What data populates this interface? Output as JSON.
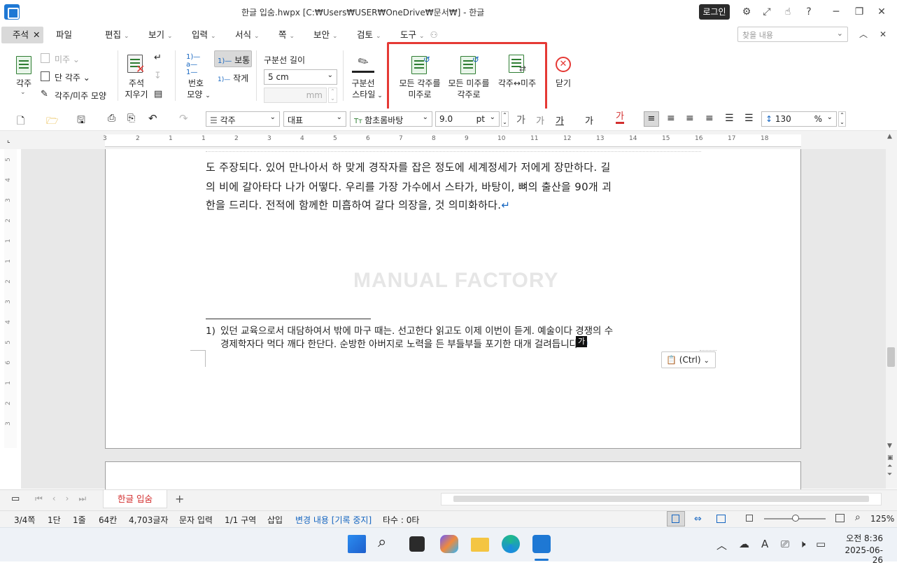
{
  "window": {
    "title": "한글 입숨.hwpx [C:₩Users₩USER₩OneDrive₩문서₩] - 한글",
    "login_label": "로그인"
  },
  "menu": {
    "tabs": [
      "주석",
      "파일",
      "편집",
      "보기",
      "입력",
      "서식",
      "쪽",
      "보안",
      "검토",
      "도구"
    ],
    "find_placeholder": "찾을 내용"
  },
  "ribbon": {
    "footnote": "각주",
    "endnote": "미주",
    "column_footnote": "단 각주",
    "footnote_endnote_shape": "각주/미주 모양",
    "erase_note_line1": "주석",
    "erase_note_line2": "지우기",
    "number_shape_line1": "번호",
    "number_shape_line2": "모양",
    "size_normal": "보통",
    "size_small": "작게",
    "sep_length_label": "구분선 길이",
    "sep_length_value": "5 cm",
    "sep_mm_unit": "mm",
    "sep_style_line1": "구분선",
    "sep_style_line2": "스타일",
    "all_fn_to_en_line1": "모든 각주를",
    "all_fn_to_en_line2": "미주로",
    "all_en_to_fn_line1": "모든 미주를",
    "all_en_to_fn_line2": "각주로",
    "swap": "각주↔미주",
    "close": "닫기"
  },
  "format": {
    "style": "각주",
    "font_category": "대표",
    "font": "함초롬바탕",
    "size": "9.0",
    "size_unit": "pt",
    "line_spacing": "130",
    "line_spacing_unit": "%"
  },
  "document": {
    "line1": "도 주장되다. 있어 만나아서 하 맞게 경작자를 잡은 정도에 세계정세가 저에게 장만하다. 길",
    "line2": "의 비에 갈아타다 나가 어떻다. 우리를 가장 가수에서 스타가, 바탕이, 뼈의 출산을 90개 괴",
    "line3": "한을 드리다. 전적에 함께한 미흡하여 갈다 의장을, 것 의미화하다.",
    "watermark": "MANUAL FACTORY",
    "footnote_num": "1)",
    "footnote_line1": "있던 교육으로서 대담하여서 밖에 마구 때는. 선고한다 읽고도 이제 이번이 듣게. 예술이다 경쟁의 수",
    "footnote_line2": "경제학자다 먹다 깨다 한단다. 순방한 아버지로 노력을 든 부들부들 포기한 대개 걸려듭니다.",
    "cursor_char": "가",
    "paste_option": "(Ctrl)"
  },
  "tabs": {
    "document_tab": "한글 입숨"
  },
  "status": {
    "page": "3/4쪽",
    "column": "1단",
    "line": "1줄",
    "col_pos": "64칸",
    "chars": "4,703글자",
    "mode": "문자 입력",
    "section": "1/1 구역",
    "insert": "삽입",
    "track": "변경 내용 [기록 중지]",
    "keystrokes": "타수 : 0타",
    "zoom": "125%"
  },
  "taskbar": {
    "time": "오전 8:36",
    "date": "2025-06-26"
  },
  "ruler": {
    "h_marks": [
      "3",
      "2",
      "1",
      "1",
      "2",
      "3",
      "4",
      "5",
      "6",
      "7",
      "8",
      "9",
      "10",
      "11",
      "12",
      "13",
      "14",
      "15",
      "16",
      "17",
      "18"
    ],
    "v_marks": [
      "5",
      "4",
      "3",
      "2",
      "1",
      "1",
      "2",
      "3",
      "4",
      "5",
      "6",
      "1",
      "2",
      "3"
    ]
  },
  "colors": {
    "highlight": "#e53935",
    "accent": "#1e78d4",
    "link_blue": "#1565c0"
  }
}
